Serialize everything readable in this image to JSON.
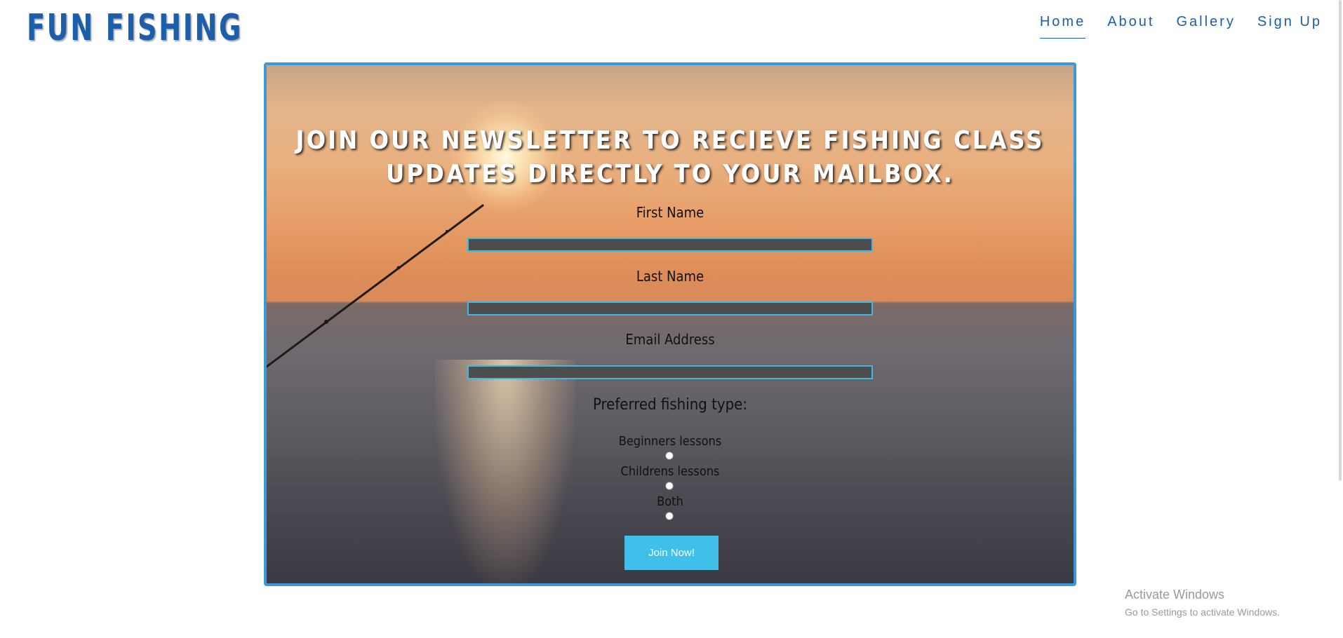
{
  "header": {
    "logo": "FUN FISHING",
    "nav": [
      {
        "label": "Home",
        "active": true
      },
      {
        "label": "About",
        "active": false
      },
      {
        "label": "Gallery",
        "active": false
      },
      {
        "label": "Sign Up",
        "active": false
      }
    ]
  },
  "hero": {
    "title": "JOIN OUR NEWSLETTER TO RECIEVE FISHING CLASS UPDATES DIRECTLY TO YOUR MAILBOX.",
    "fields": {
      "first_name": {
        "label": "First Name",
        "value": ""
      },
      "last_name": {
        "label": "Last Name",
        "value": ""
      },
      "email": {
        "label": "Email Address",
        "value": ""
      }
    },
    "preference": {
      "title": "Preferred fishing type:",
      "options": [
        "Beginners lessons",
        "Childrens lessons",
        "Both"
      ]
    },
    "submit_label": "Join Now!"
  },
  "windows_watermark": {
    "title": "Activate Windows",
    "subtitle": "Go to Settings to activate Windows."
  },
  "colors": {
    "brand": "#1c5ea8",
    "accent": "#40c0e8",
    "frame": "#3a9ad9"
  }
}
